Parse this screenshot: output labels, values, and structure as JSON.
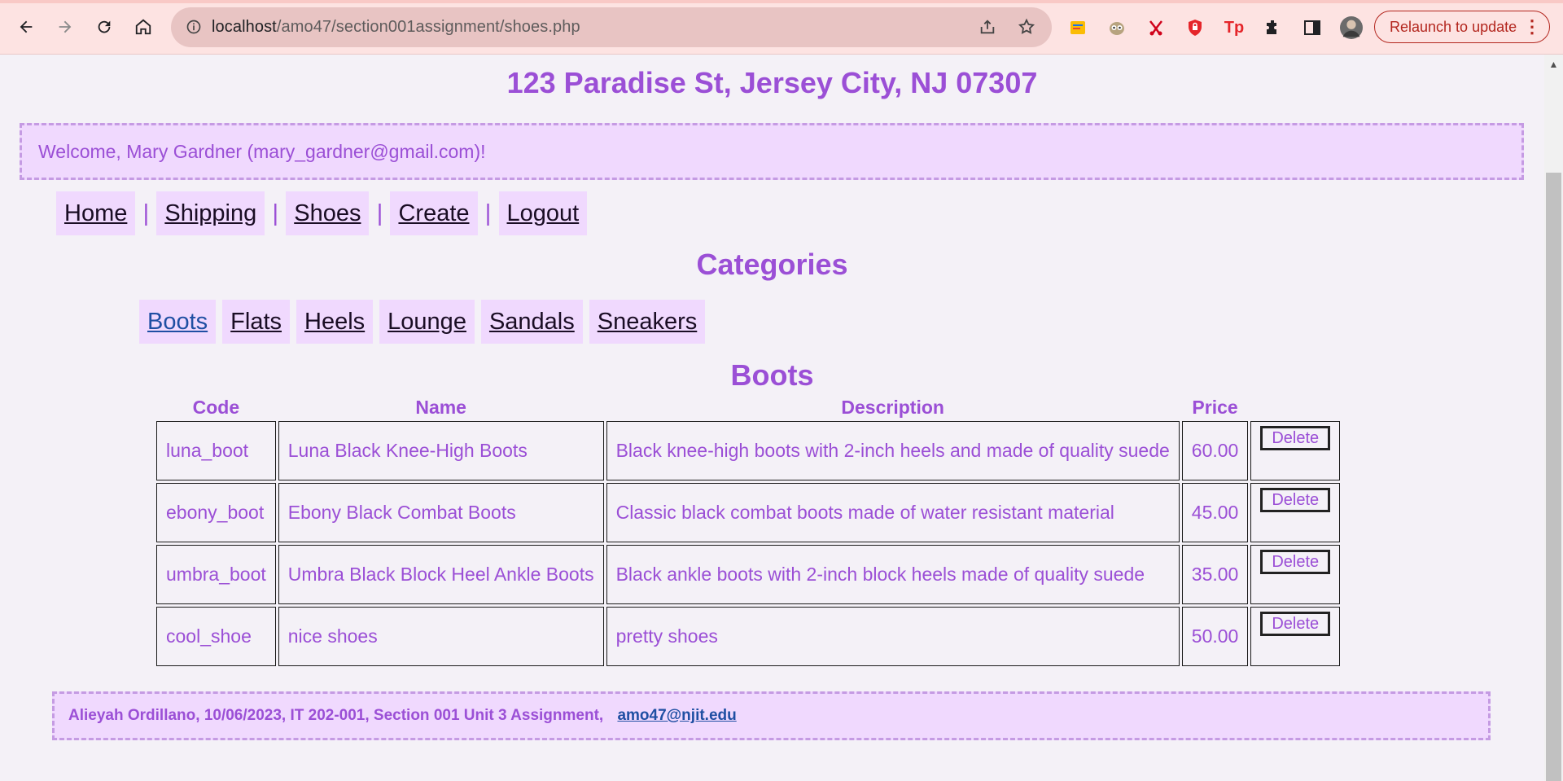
{
  "browser": {
    "url_host": "localhost",
    "url_path": "/amo47/section001assignment/shoes.php",
    "relaunch_label": "Relaunch to update",
    "icons": [
      "back-icon",
      "forward-icon",
      "reload-icon",
      "home-icon",
      "info-icon",
      "share-icon",
      "star-icon",
      "extensions-icon",
      "side-panel-icon",
      "profile-avatar",
      "menu-icon"
    ],
    "accent": "#b3261e"
  },
  "header": {
    "address": "123 Paradise St, Jersey City, NJ 07307",
    "welcome": "Welcome, Mary Gardner (mary_gardner@gmail.com)!"
  },
  "nav": {
    "items": [
      "Home",
      "Shipping",
      "Shoes",
      "Create",
      "Logout"
    ],
    "separator": "|"
  },
  "categories": {
    "title": "Categories",
    "items": [
      "Boots",
      "Flats",
      "Heels",
      "Lounge",
      "Sandals",
      "Sneakers"
    ],
    "selected": "Boots"
  },
  "section": {
    "title": "Boots",
    "columns": [
      "Code",
      "Name",
      "Description",
      "Price"
    ],
    "delete_label": "Delete",
    "rows": [
      {
        "code": "luna_boot",
        "name": "Luna Black Knee-High Boots",
        "description": "Black knee-high boots with 2-inch heels and made of quality suede",
        "price": "60.00"
      },
      {
        "code": "ebony_boot",
        "name": "Ebony Black Combat Boots",
        "description": "Classic black combat boots made of water resistant material",
        "price": "45.00"
      },
      {
        "code": "umbra_boot",
        "name": "Umbra Black Block Heel Ankle Boots",
        "description": "Black ankle boots with 2-inch block heels made of quality suede",
        "price": "35.00"
      },
      {
        "code": "cool_shoe",
        "name": "nice shoes",
        "description": "pretty shoes",
        "price": "50.00"
      }
    ]
  },
  "footer": {
    "text": "Alieyah Ordillano, 10/06/2023, IT 202-001, Section 001 Unit 3 Assignment,",
    "email": "amo47@njit.edu"
  },
  "colors": {
    "brand_purple": "#9b4fd6",
    "panel_bg": "#f0d9fe",
    "link_blue": "#1f4fa3"
  }
}
